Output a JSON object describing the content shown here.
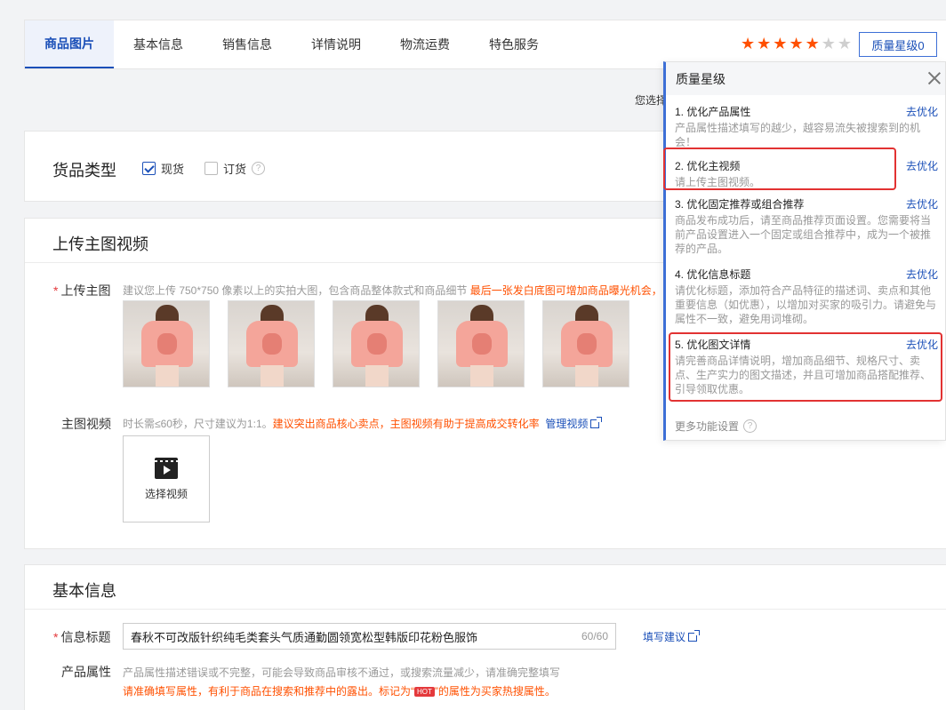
{
  "tabs": [
    "商品图片",
    "基本信息",
    "销售信息",
    "详情说明",
    "物流运费",
    "特色服务"
  ],
  "quality": {
    "stars_filled": 5,
    "stars_total": 7,
    "button_label": "质量星级0"
  },
  "hint_partial": "您选择",
  "goods_type": {
    "title": "货品类型",
    "option1": "现货",
    "option2": "订货"
  },
  "upload": {
    "title": "上传主图视频",
    "main_image_label": "上传主图",
    "main_image_tip": "建议您上传 750*750 像素以上的实拍大图，包含商品整体款式和商品细节 ",
    "main_image_tip_orange": "最后一张发白底图可增加商品曝光机会，",
    "video_label": "主图视频",
    "video_tip": "时长需≤60秒，尺寸建议为1:1。",
    "video_tip_orange": "建议突出商品核心卖点，主图视频有助于提高成交转化率",
    "manage_video": "管理视频",
    "select_video": "选择视频"
  },
  "basic": {
    "title": "基本信息",
    "title_label": "信息标题",
    "title_value": "春秋不可改版针织纯毛类套头气质通勤圆领宽松型韩版印花粉色服饰",
    "title_counter": "60/60",
    "fill_suggestion": "填写建议",
    "attr_label": "产品属性",
    "attr_tip": "产品属性描述错误或不完整，可能会导致商品审核不通过，或搜索流量减少，请准确完整填写",
    "attr_orange_1": "请准确填写属性，有利于商品在搜索和推荐中的露出。标记为“",
    "attr_hot": "HOT",
    "attr_orange_2": "”的属性为买家热搜属性。"
  },
  "panel": {
    "title": "质量星级",
    "go_label": "去优化",
    "items": [
      {
        "title": "1. 优化产品属性",
        "desc": "产品属性描述填写的越少，越容易流失被搜索到的机会！"
      },
      {
        "title": "2. 优化主视频",
        "desc": "请上传主图视频。"
      },
      {
        "title": "3. 优化固定推荐或组合推荐",
        "desc": "商品发布成功后，请至商品推荐页面设置。您需要将当前产品设置进入一个固定或组合推荐中，成为一个被推荐的产品。"
      },
      {
        "title": "4. 优化信息标题",
        "desc": "请优化标题，添加符合产品特征的描述词、卖点和其他重要信息（如优惠），以增加对买家的吸引力。请避免与属性不一致，避免用词堆砌。"
      },
      {
        "title": "5. 优化图文详情",
        "desc": "请完善商品详情说明，增加商品细节、规格尺寸、卖点、生产实力的图文描述，并且可增加商品搭配推荐、引导领取优惠。"
      }
    ],
    "more": "更多功能设置"
  },
  "colors": {
    "accent": "#1a4fb8",
    "orange": "#ff5000",
    "highlight": "#e23232"
  }
}
